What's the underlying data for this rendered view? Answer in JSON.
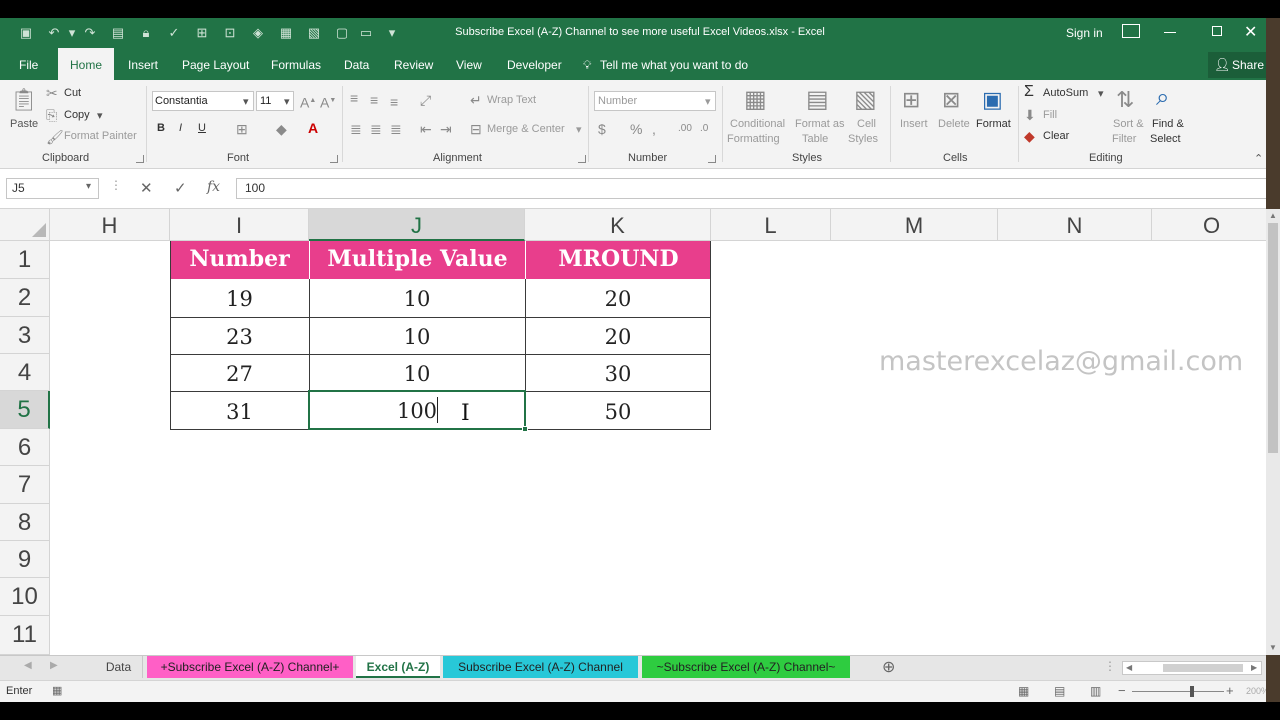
{
  "window": {
    "title": "Subscribe Excel (A-Z) Channel to see more useful Excel Videos.xlsx - Excel",
    "sign_in": "Sign in",
    "share": "Share"
  },
  "menu": {
    "items": [
      "File",
      "Home",
      "Insert",
      "Page Layout",
      "Formulas",
      "Data",
      "Review",
      "View",
      "Developer"
    ],
    "tell_me": "Tell me what you want to do"
  },
  "ribbon": {
    "clipboard": {
      "paste": "Paste",
      "cut": "Cut",
      "copy": "Copy",
      "format_painter": "Format Painter",
      "label": "Clipboard"
    },
    "font": {
      "name": "Constantia",
      "size": "11",
      "bold": "B",
      "italic": "I",
      "underline": "U",
      "label": "Font"
    },
    "alignment": {
      "wrap_text": "Wrap Text",
      "merge_center": "Merge & Center",
      "label": "Alignment"
    },
    "number": {
      "format": "Number",
      "label": "Number"
    },
    "styles": {
      "conditional": "Conditional",
      "formatting": "Formatting",
      "format_as": "Format as",
      "table": "Table",
      "cell": "Cell",
      "styles": "Styles",
      "label": "Styles"
    },
    "cells": {
      "insert": "Insert",
      "delete": "Delete",
      "format": "Format",
      "label": "Cells"
    },
    "editing": {
      "autosum": "AutoSum",
      "fill": "Fill",
      "clear": "Clear",
      "sort": "Sort &",
      "filter": "Filter",
      "find": "Find &",
      "select": "Select",
      "label": "Editing"
    }
  },
  "formula_bar": {
    "name_box": "J5",
    "value": "100",
    "fx": "fx"
  },
  "columns": [
    "H",
    "I",
    "J",
    "K",
    "L",
    "M",
    "N",
    "O"
  ],
  "rows": [
    "1",
    "2",
    "3",
    "4",
    "5",
    "6",
    "7",
    "8",
    "9",
    "10",
    "11"
  ],
  "table": {
    "headers": [
      "Number",
      "Multiple Value",
      "MROUND"
    ],
    "rows": [
      [
        "19",
        "10",
        "20"
      ],
      [
        "23",
        "10",
        "20"
      ],
      [
        "27",
        "10",
        "30"
      ],
      [
        "31",
        "100",
        "50"
      ]
    ]
  },
  "watermark": "masterexcelaz@gmail.com",
  "sheets": [
    "Data",
    "+Subscribe Excel (A-Z) Channel+",
    "Excel (A-Z)",
    "Subscribe Excel (A-Z) Channel",
    "~Subscribe Excel (A-Z) Channel~"
  ],
  "status": {
    "mode": "Enter",
    "zoom": "200%"
  },
  "colors": {
    "excel_green": "#217346",
    "header_pink": "#e83e8c",
    "tab_pink": "#ff5fc6",
    "tab_cyan": "#28c8d8",
    "tab_green": "#2ecc40"
  }
}
